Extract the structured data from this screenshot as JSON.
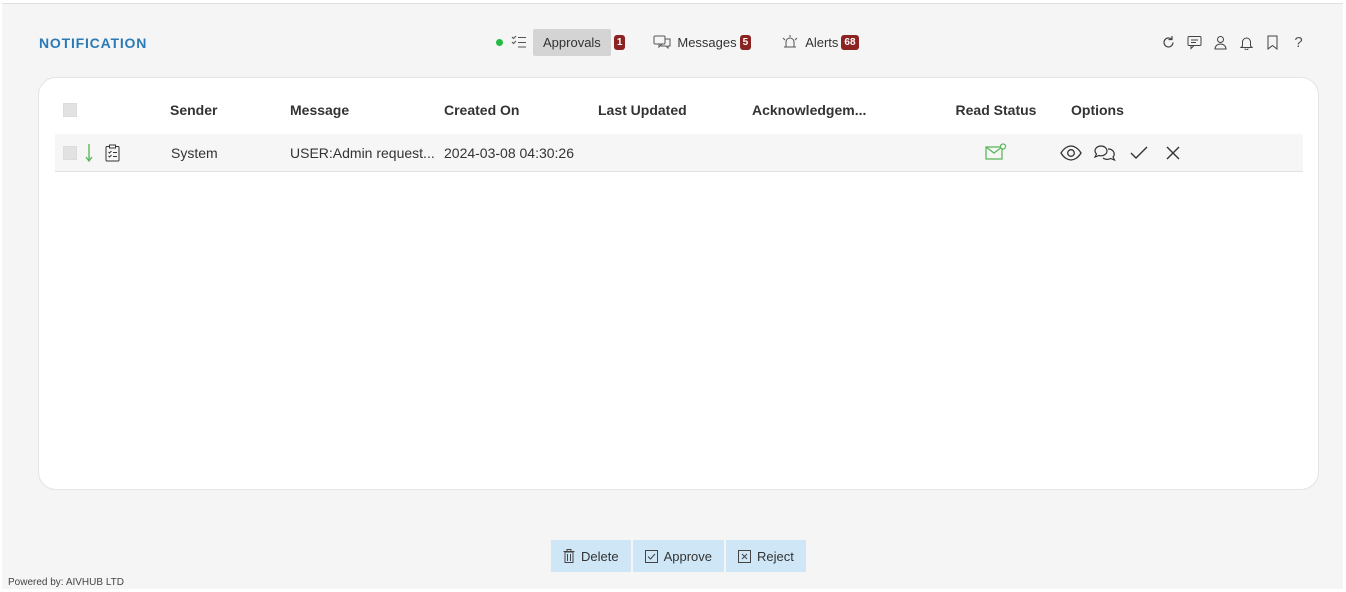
{
  "page": {
    "title": "NOTIFICATION"
  },
  "tabs": [
    {
      "label": "Approvals",
      "count": "1",
      "icon": "checklist-icon",
      "active": true
    },
    {
      "label": "Messages",
      "count": "5",
      "icon": "chat-icon",
      "active": false
    },
    {
      "label": "Alerts",
      "count": "68",
      "icon": "alarm-icon",
      "active": false
    }
  ],
  "top_icons": [
    "refresh-icon",
    "comment-icon",
    "user-icon",
    "bell-icon",
    "bookmark-icon",
    "help-icon"
  ],
  "help_glyph": "?",
  "table": {
    "columns": [
      "Sender",
      "Message",
      "Created On",
      "Last Updated",
      "Acknowledgem...",
      "Read Status",
      "Options"
    ],
    "rows": [
      {
        "sender": "System",
        "message": "USER:Admin request...",
        "created_on": "2024-03-08 04:30:26",
        "last_updated": "",
        "acknowledgement": "",
        "read_status_icon": "mail-read-icon"
      }
    ]
  },
  "actions": {
    "delete": "Delete",
    "approve": "Approve",
    "reject": "Reject"
  },
  "footer": {
    "text": "Powered by: AIVHUB LTD"
  },
  "colors": {
    "accent": "#2a7ab8",
    "badge": "#8b2323",
    "status_green": "#5cb85c",
    "action_bg": "#cfe6f7"
  }
}
